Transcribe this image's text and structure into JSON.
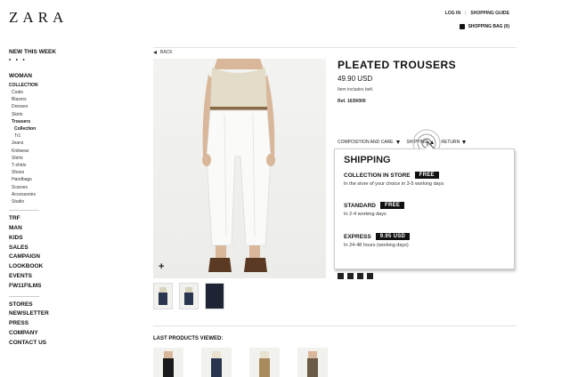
{
  "header": {
    "logo": "ZARA",
    "login": "LOG IN",
    "separator": "|",
    "shopping_guide": "SHOPPING GUIDE",
    "shopping_bag": "SHOPPING BAG (0)"
  },
  "sidebar": {
    "new_this_week": "NEW THIS WEEK",
    "dots": "• • •",
    "woman": "WOMAN",
    "collection": "COLLECTION",
    "items": [
      "Coats",
      "Blazers",
      "Dresses",
      "Skirts",
      "Trousers",
      "Collection",
      "Tr1",
      "Jeans",
      "Knitwear",
      "Shirts",
      "T-shirts",
      "Shoes",
      "Handbags",
      "Scarves",
      "Accessories",
      "Studio"
    ],
    "sections": [
      "TRF",
      "MAN",
      "KIDS",
      "SALES",
      "CAMPAIGN",
      "LOOKBOOK",
      "EVENTS",
      "FW11FILMS"
    ],
    "footer": [
      "STORES",
      "NEWSLETTER",
      "PRESS",
      "COMPANY",
      "CONTACT US"
    ]
  },
  "back": "BACK",
  "product": {
    "name": "PLEATED TROUSERS",
    "price": "49.90 USD",
    "note": "Item includes belt.",
    "ref": "Ref. 1639/000",
    "zoom": "+"
  },
  "tabs": {
    "composition": "COMPOSITION AND CARE",
    "shipping": "SHIPPING",
    "return": "RETURN"
  },
  "shipping_popup": {
    "title": "SHIPPING",
    "options": [
      {
        "name": "COLLECTION IN STORE",
        "badge": "FREE",
        "desc": "In the store of your choice in 3-5 working days"
      },
      {
        "name": "STANDARD",
        "badge": "FREE",
        "desc": "In 2-4 working days"
      },
      {
        "name": "EXPRESS",
        "badge": "9.95 USD",
        "desc": "In 24-48 hours (working days)"
      }
    ]
  },
  "last_products_viewed": "LAST PRODUCTS VIEWED:",
  "colors": {
    "accent": "#111111",
    "background": "#ffffff",
    "photo_bg": "#efefec"
  }
}
